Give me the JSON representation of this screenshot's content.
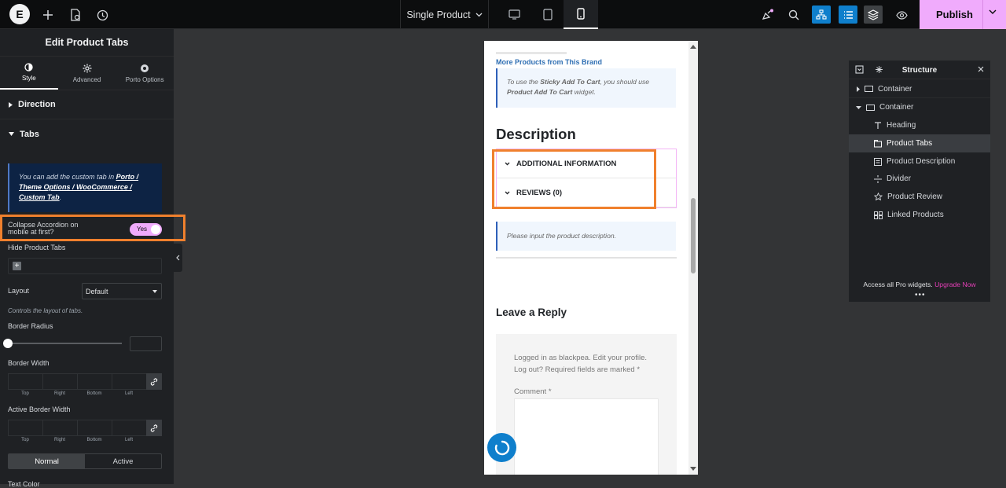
{
  "topbar": {
    "logo_glyph": "E",
    "doc_title": "Single Product",
    "publish_label": "Publish",
    "accent_color": "#f0abfc",
    "icons": [
      "plus-icon",
      "page-settings-icon",
      "history-icon",
      "desktop-icon",
      "tablet-icon",
      "mobile-icon",
      "whats-new-icon",
      "search-icon",
      "structure-icon",
      "navigator-icon",
      "layers-icon",
      "preview-icon"
    ]
  },
  "panel": {
    "title": "Edit Product Tabs",
    "tabs": [
      {
        "label": "Style",
        "icon": "half-circle-icon",
        "active": true
      },
      {
        "label": "Advanced",
        "icon": "gear-icon",
        "active": false
      },
      {
        "label": "Porto Options",
        "icon": "circle-dot-icon",
        "active": false
      }
    ],
    "sections": {
      "direction": "Direction",
      "tabs": "Tabs"
    },
    "notice": {
      "prefix": "You can add the custom tab in ",
      "link": "Porto / Theme Options / WooCommerce / Custom Tab",
      "suffix": "."
    },
    "collapse_label_line1": "Collapse Accordion on",
    "collapse_label_line2": "mobile at first?",
    "collapse_toggle": "Yes",
    "hide_tabs_label": "Hide Product Tabs",
    "layout_label": "Layout",
    "layout_value": "Default",
    "layout_hint": "Controls the layout of tabs.",
    "border_radius_label": "Border Radius",
    "border_width_label": "Border Width",
    "active_border_width_label": "Active Border Width",
    "dim_labels": [
      "Top",
      "Right",
      "Bottom",
      "Left"
    ],
    "state_tabs": [
      "Normal",
      "Active"
    ],
    "text_color_label": "Text Color"
  },
  "canvas": {
    "more_brand": "More Products from This Brand",
    "sticky_notice": {
      "a": "To use the ",
      "b": "Sticky Add To Cart",
      "c": ", you should use ",
      "d": "Product Add To Cart",
      "e": " widget."
    },
    "description_title": "Description",
    "accordion": [
      "ADDITIONAL INFORMATION",
      "REVIEWS (0)"
    ],
    "desc_notice": "Please input the product description.",
    "reply_title": "Leave a Reply",
    "logged_in_line1": "Logged in as blackpea. Edit your profile.",
    "logged_in_line2": "Log out? Required fields are marked *",
    "comment_label": "Comment *"
  },
  "navigator": {
    "title": "Structure",
    "items": [
      {
        "label": "Container",
        "icon": "container-icon",
        "level": 0,
        "expanded": false
      },
      {
        "label": "Container",
        "icon": "container-icon",
        "level": 0,
        "expanded": true
      },
      {
        "label": "Heading",
        "icon": "heading-icon",
        "level": 1
      },
      {
        "label": "Product Tabs",
        "icon": "product-tabs-icon",
        "level": 1,
        "selected": true
      },
      {
        "label": "Product Description",
        "icon": "product-description-icon",
        "level": 1
      },
      {
        "label": "Divider",
        "icon": "divider-icon",
        "level": 1
      },
      {
        "label": "Product Review",
        "icon": "star-icon",
        "level": 1
      },
      {
        "label": "Linked Products",
        "icon": "linked-products-icon",
        "level": 1
      }
    ],
    "promo_text": "Access all Pro widgets.",
    "promo_link": "Upgrade Now"
  }
}
